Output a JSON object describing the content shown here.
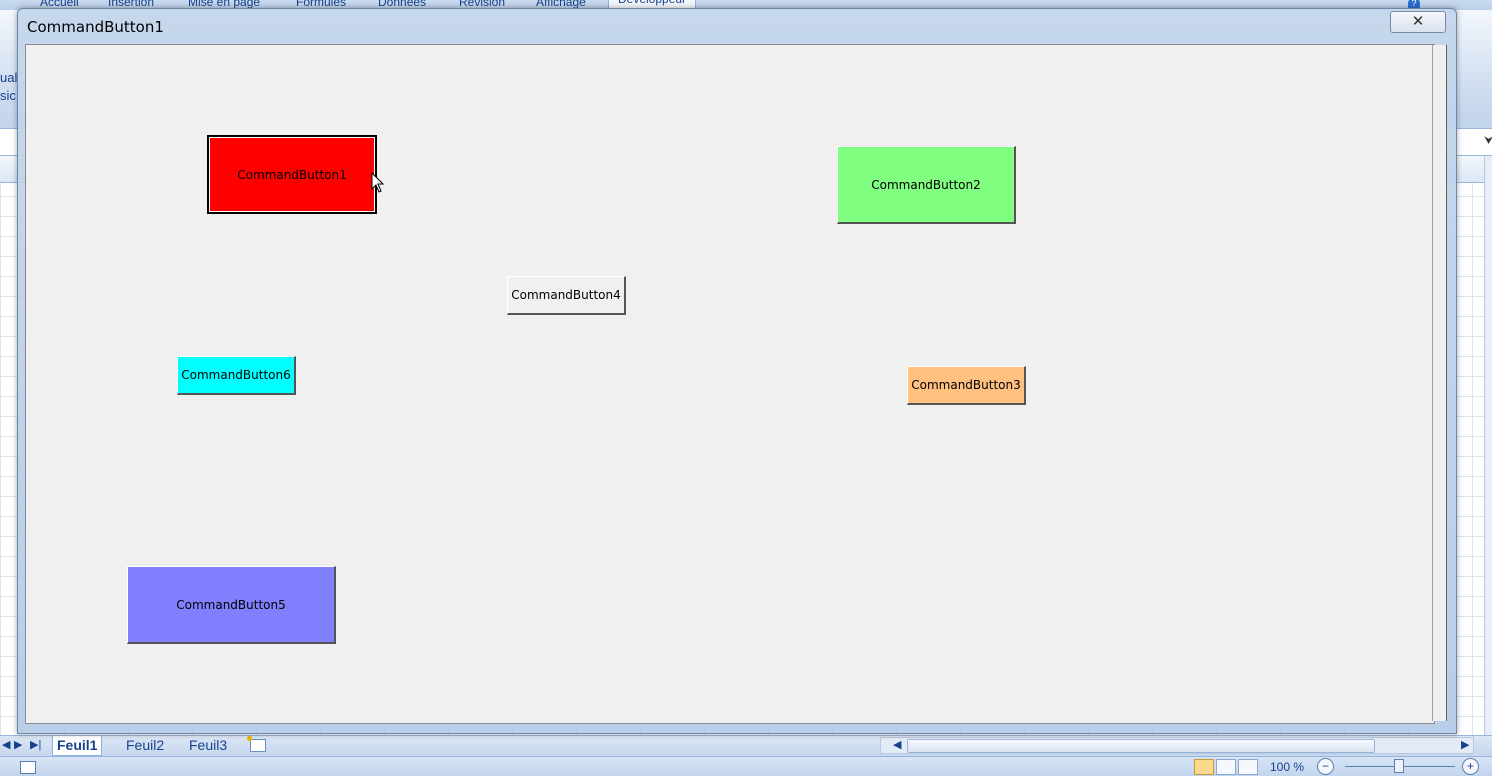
{
  "ribbon": {
    "tabs": [
      "Accueil",
      "Insertion",
      "Mise en page",
      "Formules",
      "Données",
      "Révision",
      "Affichage",
      "Développeur"
    ],
    "active_tab": "Développeur",
    "left_fragment_1": "ual",
    "left_fragment_2": "sic"
  },
  "userform": {
    "title": "CommandButton1",
    "close_glyph": "✕",
    "buttons": [
      {
        "id": "CommandButton1",
        "label": "CommandButton1",
        "color": "#ff0000"
      },
      {
        "id": "CommandButton2",
        "label": "CommandButton2",
        "color": "#80ff80"
      },
      {
        "id": "CommandButton3",
        "label": "CommandButton3",
        "color": "#ffc080"
      },
      {
        "id": "CommandButton4",
        "label": "CommandButton4",
        "color": "#f0f0f0"
      },
      {
        "id": "CommandButton5",
        "label": "CommandButton5",
        "color": "#8080ff"
      },
      {
        "id": "CommandButton6",
        "label": "CommandButton6",
        "color": "#00ffff"
      }
    ]
  },
  "sheets": {
    "tabs": [
      "Feuil1",
      "Feuil2",
      "Feuil3"
    ],
    "active": "Feuil1"
  },
  "statusbar": {
    "zoom_label": "100 %",
    "zoom_minus": "−",
    "zoom_plus": "+"
  }
}
